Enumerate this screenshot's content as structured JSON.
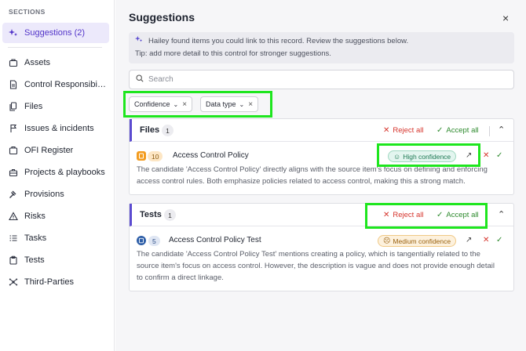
{
  "sidebar": {
    "section_title": "SECTIONS",
    "items": [
      {
        "label": "Suggestions (2)",
        "icon": "sparkles-icon",
        "active": true
      },
      {
        "label": "Assets",
        "icon": "box-icon"
      },
      {
        "label": "Control Responsibili...",
        "icon": "document-icon"
      },
      {
        "label": "Files",
        "icon": "files-icon"
      },
      {
        "label": "Issues & incidents",
        "icon": "flag-icon"
      },
      {
        "label": "OFI Register",
        "icon": "register-icon"
      },
      {
        "label": "Projects & playbooks",
        "icon": "briefcase-icon"
      },
      {
        "label": "Provisions",
        "icon": "gavel-icon"
      },
      {
        "label": "Risks",
        "icon": "warning-icon"
      },
      {
        "label": "Tasks",
        "icon": "list-icon"
      },
      {
        "label": "Tests",
        "icon": "clipboard-icon"
      },
      {
        "label": "Third-Parties",
        "icon": "network-icon"
      }
    ]
  },
  "panel": {
    "title": "Suggestions",
    "close_label": "×",
    "info_line1": "Hailey found items you could link to this record. Review the suggestions below.",
    "info_line2": "Tip: add more detail to this control for stronger suggestions.",
    "search_placeholder": "Search",
    "filters": [
      {
        "label": "Confidence"
      },
      {
        "label": "Data type"
      }
    ]
  },
  "groups": [
    {
      "title": "Files",
      "count": "1",
      "reject_all": "Reject all",
      "accept_all": "Accept all",
      "item": {
        "badge": "10",
        "name": "Access Control Policy",
        "confidence": "High confidence",
        "description_line1": "The candidate 'Access Control Policy' directly aligns with the source item's focus on defining and enforcing",
        "description_line2": "access control rules. Both emphasize policies related to access control, making this a strong match."
      }
    },
    {
      "title": "Tests",
      "count": "1",
      "reject_all": "Reject all",
      "accept_all": "Accept all",
      "item": {
        "badge": "5",
        "name": "Access Control Policy Test",
        "confidence": "Medium confidence",
        "description_line1": "The candidate 'Access Control Policy Test' mentions creating a policy, which is tangentially related to the",
        "description_line2": "source item's focus on access control. However, the description is vague and does not provide enough detail",
        "description_line3": "to confirm a direct linkage."
      }
    }
  ],
  "colors": {
    "accent": "#5b4bd0",
    "reject": "#d6342c",
    "accept": "#2d8a2d",
    "highlight": "#1ee61e",
    "high_confidence_bg": "#e3f5ef",
    "medium_confidence_bg": "#fdf1dd"
  }
}
